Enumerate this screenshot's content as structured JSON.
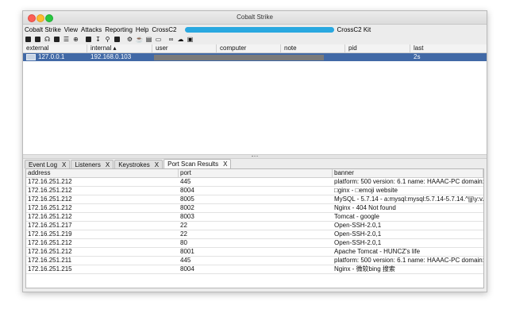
{
  "window": {
    "title": "Cobalt Strike"
  },
  "menu": {
    "items": [
      "Cobalt Strike",
      "View",
      "Attacks",
      "Reporting",
      "Help",
      "CrossC2"
    ],
    "plugin_label": "CrossC2 Kit"
  },
  "toolbar": {
    "icons": [
      "plus-square-icon",
      "minus-square-icon",
      "headphones-icon",
      "share-icon",
      "list-icon",
      "target-icon",
      "image-icon",
      "download-icon",
      "key-icon",
      "picture-icon",
      "gear-icon",
      "coffee-icon",
      "document-icon",
      "terminal-icon",
      "link-icon",
      "cloud-icon",
      "cube-icon"
    ]
  },
  "beacons": {
    "columns": [
      {
        "label": "external",
        "width": 81
      },
      {
        "label": "internal ▴",
        "width": 82
      },
      {
        "label": "user",
        "width": 81
      },
      {
        "label": "computer",
        "width": 81
      },
      {
        "label": "note",
        "width": 81
      },
      {
        "label": "pid",
        "width": 82
      },
      {
        "label": "last",
        "width": 96
      }
    ],
    "rows": [
      {
        "external": "127.0.0.1",
        "internal": "192.168.0.103",
        "last": "2s"
      }
    ]
  },
  "tabs": [
    {
      "label": "Event Log",
      "close": "X",
      "active": false
    },
    {
      "label": "Listeners",
      "close": "X",
      "active": false
    },
    {
      "label": "Keystrokes",
      "close": "X",
      "active": false
    },
    {
      "label": "Port Scan Results",
      "close": "X",
      "active": true
    }
  ],
  "scan": {
    "columns": [
      "address",
      "port",
      "banner"
    ],
    "rows": [
      [
        "172.16.251.212",
        "445",
        "platform: 500 version: 6.1 name: HAAAC-PC domain: ..."
      ],
      [
        "172.16.251.212",
        "8004",
        "□ginx - □emoji website"
      ],
      [
        "172.16.251.212",
        "8005",
        "MySQL - 5.7.14 - a:mysql:mysql:5.7.14-5.7.14.^|jj\\y:v..."
      ],
      [
        "172.16.251.212",
        "8002",
        "Nginx - 404 Not found"
      ],
      [
        "172.16.251.212",
        "8003",
        "Tomcat - google"
      ],
      [
        "172.16.251.217",
        "22",
        "Open-SSH-2.0,1"
      ],
      [
        "172.16.251.219",
        "22",
        "Open-SSH-2.0,1"
      ],
      [
        "172.16.251.212",
        "80",
        "Open-SSH-2.0,1"
      ],
      [
        "172.16.251.212",
        "8001",
        "Apache Tomcat - HUNCZ's life"
      ],
      [
        "172.16.251.211",
        "445",
        "platform: 500 version: 6.1 name: HAAAC-PC domain: ..."
      ],
      [
        "172.16.251.215",
        "8004",
        "Nginx - 微软bing 搜索"
      ]
    ]
  }
}
